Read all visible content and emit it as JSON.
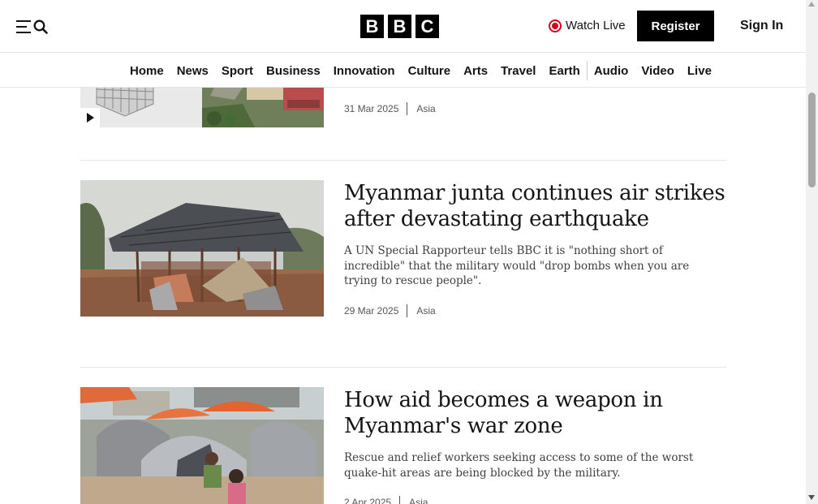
{
  "header": {
    "logo_letters": [
      "B",
      "B",
      "C"
    ],
    "watch_live": "Watch Live",
    "register": "Register",
    "sign_in": "Sign In"
  },
  "nav": {
    "items": [
      "Home",
      "News",
      "Sport",
      "Business",
      "Innovation",
      "Culture",
      "Arts",
      "Travel",
      "Earth",
      "Audio",
      "Video",
      "Live"
    ]
  },
  "articles": [
    {
      "date": "31 Mar 2025",
      "region": "Asia",
      "has_video": true
    },
    {
      "headline": "Myanmar junta continues air strikes after devastating earthquake",
      "summary": "A UN Special Rapporteur tells BBC it is \"nothing short of incredible\" that the military would \"drop bombs when you are trying to rescue people\".",
      "date": "29 Mar 2025",
      "region": "Asia"
    },
    {
      "headline": "How aid becomes a weapon in Myanmar's war zone",
      "summary": "Rescue and relief workers seeking access to some of the worst quake-hit areas are being blocked by the military.",
      "date": "2 Apr 2025",
      "region": "Asia"
    }
  ],
  "colors": {
    "brand_black": "#000000",
    "live_red": "#d4021c",
    "text": "#141414",
    "rule": "#e6e6e6"
  }
}
